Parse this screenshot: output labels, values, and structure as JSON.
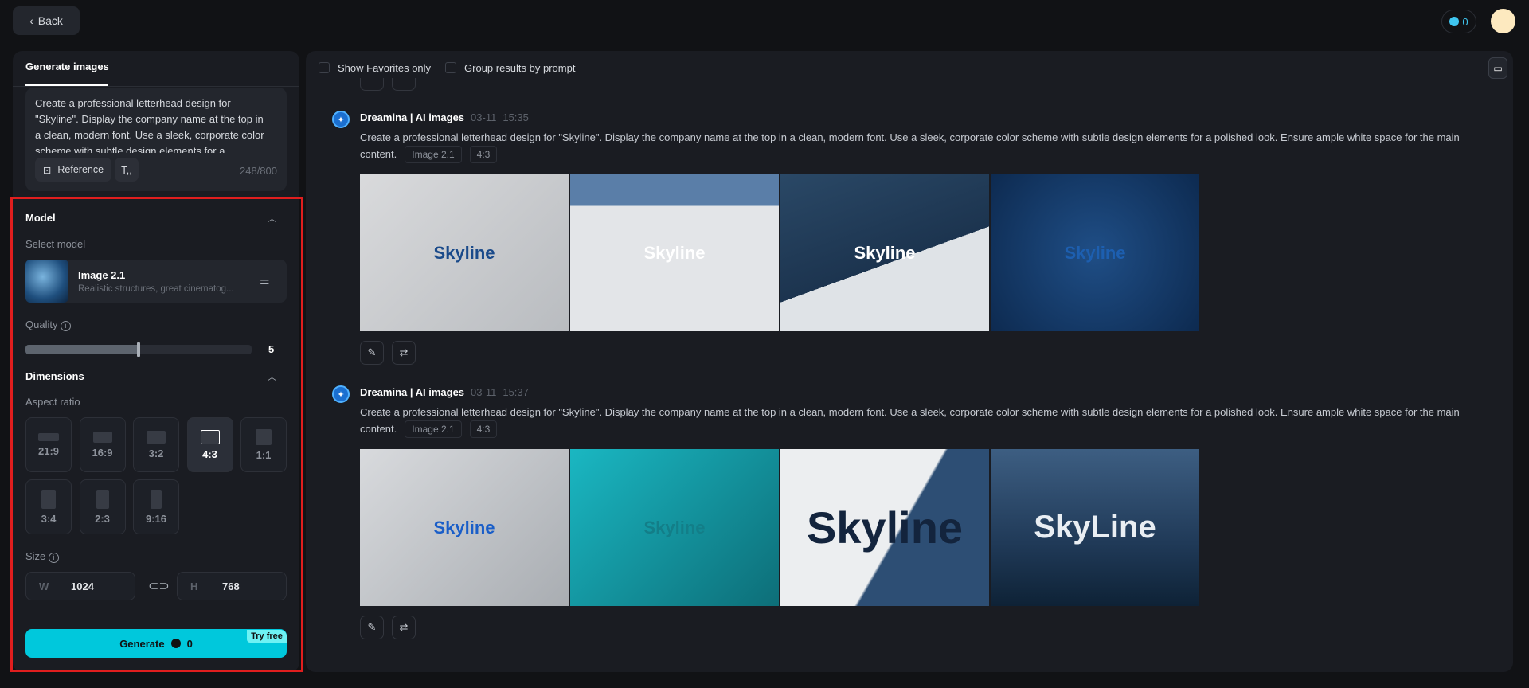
{
  "header": {
    "back_label": "Back",
    "credits": "0"
  },
  "sidebar": {
    "tab": "Generate images",
    "prompt": "Create a professional letterhead design for \"Skyline\". Display the company name at the top in a clean, modern font. Use a sleek, corporate color scheme with subtle design elements for a polished look. Ensure ample white space for the main content.",
    "reference_label": "Reference",
    "char_count": "248/800",
    "model": {
      "heading": "Model",
      "select_label": "Select model",
      "name": "Image 2.1",
      "description": "Realistic structures, great cinematog..."
    },
    "quality": {
      "label": "Quality",
      "value": "5"
    },
    "dimensions": {
      "heading": "Dimensions",
      "aspect_label": "Aspect ratio",
      "ratios": [
        "21:9",
        "16:9",
        "3:2",
        "4:3",
        "1:1",
        "3:4",
        "2:3",
        "9:16"
      ],
      "selected": "4:3",
      "size_label": "Size",
      "w_label": "W",
      "width": "1024",
      "h_label": "H",
      "height": "768"
    },
    "generate_label": "Generate",
    "generate_cost": "0",
    "try_free": "Try free"
  },
  "main": {
    "filters": {
      "favorites": "Show Favorites only",
      "group": "Group results by prompt"
    },
    "groups": [
      {
        "source": "Dreamina | AI images",
        "date": "03-11",
        "time": "15:35",
        "prompt": "Create a professional letterhead design for \"Skyline\". Display the company name at the top in a clean, modern font. Use a sleek, corporate color scheme with subtle design elements for a polished look. Ensure ample white space for the main content.",
        "model": "Image 2.1",
        "ratio": "4:3",
        "images": [
          "Skyline",
          "Skyline",
          "Skyline",
          "Skyline"
        ]
      },
      {
        "source": "Dreamina | AI images",
        "date": "03-11",
        "time": "15:37",
        "prompt": "Create a professional letterhead design for \"Skyline\". Display the company name at the top in a clean, modern font. Use a sleek, corporate color scheme with subtle design elements for a polished look. Ensure ample white space for the main content.",
        "model": "Image 2.1",
        "ratio": "4:3",
        "images": [
          "Skyline",
          "Skyline",
          "Skyline",
          "SkyLine"
        ]
      }
    ]
  }
}
